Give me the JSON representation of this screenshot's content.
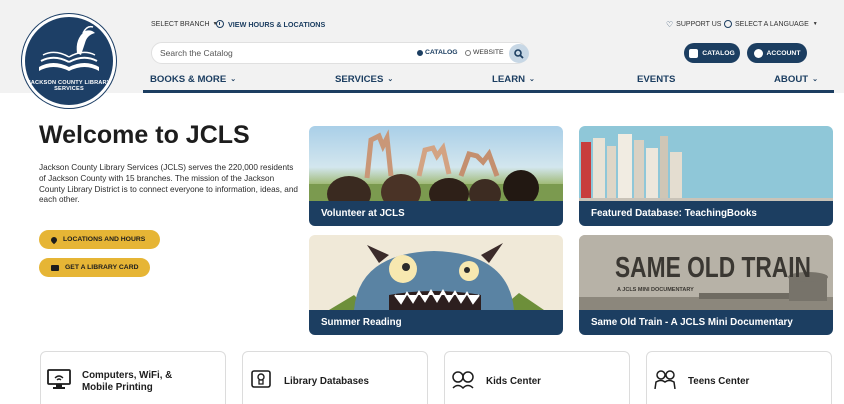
{
  "header": {
    "select_branch": "SELECT BRANCH",
    "view_hours": "VIEW HOURS & LOCATIONS",
    "support_us": "SUPPORT US",
    "select_language": "SELECT A LANGUAGE",
    "logo_text": "JACKSON COUNTY LIBRARY SERVICES"
  },
  "search": {
    "placeholder": "Search the Catalog",
    "option_catalog": "CATALOG",
    "option_website": "WEBSITE",
    "selected": "CATALOG"
  },
  "actions": {
    "catalog_label": "CATALOG",
    "account_label": "ACCOUNT"
  },
  "nav": [
    {
      "label": "BOOKS & MORE",
      "has_dropdown": true
    },
    {
      "label": "SERVICES",
      "has_dropdown": true
    },
    {
      "label": "LEARN",
      "has_dropdown": true
    },
    {
      "label": "EVENTS",
      "has_dropdown": false
    },
    {
      "label": "ABOUT",
      "has_dropdown": true
    }
  ],
  "hero": {
    "title": "Welcome to JCLS",
    "intro": "Jackson County Library Services (JCLS) serves the 220,000 residents of Jackson County with 15 branches. The mission of the Jackson County Library District is to connect everyone to information, ideas, and each other.",
    "locations_button": "LOCATIONS AND HOURS",
    "card_button": "GET A LIBRARY CARD"
  },
  "features": [
    {
      "label": "Volunteer at JCLS"
    },
    {
      "label": "Featured Database: TeachingBooks"
    },
    {
      "label": "Summer Reading"
    },
    {
      "label": "Same Old Train - A JCLS Mini Documentary",
      "image_title": "SAME OLD TRAIN",
      "image_subtitle": "A JCLS MINI DOCUMENTARY"
    }
  ],
  "categories": [
    {
      "label": "Computers, WiFi, & Mobile Printing",
      "icon": "computer-icon"
    },
    {
      "label": "Library Databases",
      "icon": "database-icon"
    },
    {
      "label": "Kids Center",
      "icon": "kids-icon"
    },
    {
      "label": "Teens Center",
      "icon": "teens-icon"
    }
  ],
  "colors": {
    "primary": "#1c3e61",
    "accent": "#e6b535",
    "header_bg": "#f2f2f2"
  }
}
